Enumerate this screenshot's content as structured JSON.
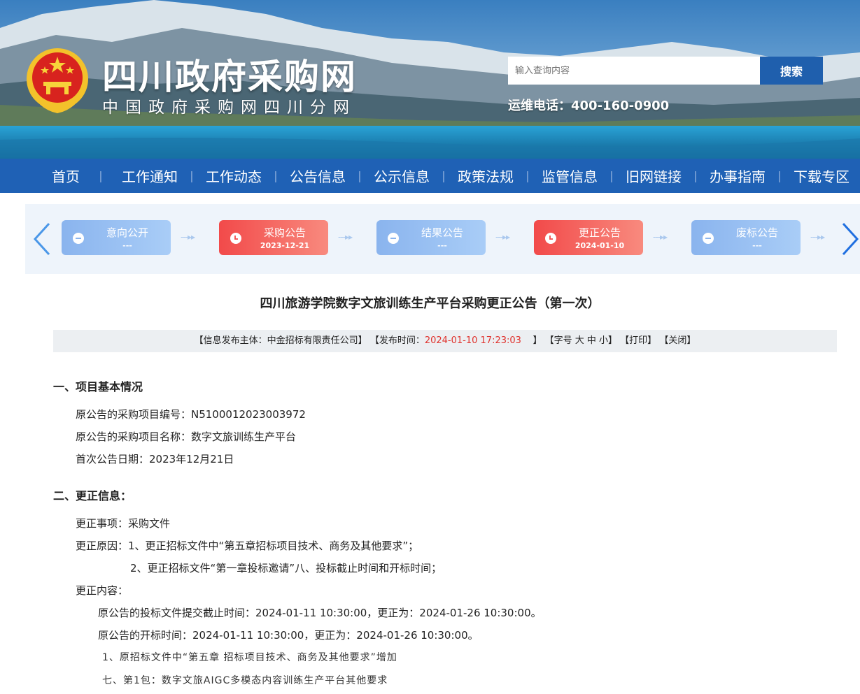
{
  "header": {
    "site_title": "四川政府采购网",
    "site_subtitle": "中国政府采购网四川分网",
    "search_placeholder": "输入查询内容",
    "search_button": "搜索",
    "hotline": "运维电话：400-160-0900"
  },
  "nav": {
    "items": [
      "首页",
      "工作通知",
      "工作动态",
      "公告信息",
      "公示信息",
      "政策法规",
      "监管信息",
      "旧网链接",
      "办事指南",
      "下载专区"
    ]
  },
  "progress": {
    "steps": [
      {
        "title": "意向公开",
        "date": "---",
        "state": "inactive"
      },
      {
        "title": "采购公告",
        "date": "2023-12-21",
        "state": "active"
      },
      {
        "title": "结果公告",
        "date": "---",
        "state": "inactive"
      },
      {
        "title": "更正公告",
        "date": "2024-01-10",
        "state": "active"
      },
      {
        "title": "废标公告",
        "date": "---",
        "state": "inactive"
      }
    ]
  },
  "article": {
    "title": "四川旅游学院数字文旅训练生产平台采购更正公告（第一次）",
    "meta": {
      "publisher": "【信息发布主体：中金招标有限责任公司】",
      "publish_label": "【发布时间：",
      "publish_time": "2024-01-10 17:23:03",
      "publish_close": "】",
      "font_size": "【字号 大 中 小】",
      "print": "【打印】",
      "close": "【关闭】"
    },
    "section1": {
      "heading": "一、项目基本情况",
      "lines": [
        "原公告的采购项目编号：N5100012023003972",
        "原公告的采购项目名称：数字文旅训练生产平台",
        "首次公告日期：2023年12月21日"
      ]
    },
    "section2": {
      "heading": "二、更正信息：",
      "item": "更正事项：采购文件",
      "reason1": "更正原因：1、更正招标文件中“第五章招标项目技术、商务及其他要求”；",
      "reason2": "2、更正招标文件“第一章投标邀请”八、投标截止时间和开标时间；",
      "content_label": "更正内容：",
      "content1": "原公告的投标文件提交截止时间：2024-01-11 10:30:00，更正为：2024-01-26 10:30:00。",
      "content2": "原公告的开标时间：2024-01-11 10:30:00，更正为：2024-01-26 10:30:00。",
      "content3": "1、原招标文件中“第五章  招标项目技术、商务及其他要求”增加",
      "content4": "七、第1包：数字文旅AIGC多模态内容训练生产平台其他要求"
    }
  }
}
